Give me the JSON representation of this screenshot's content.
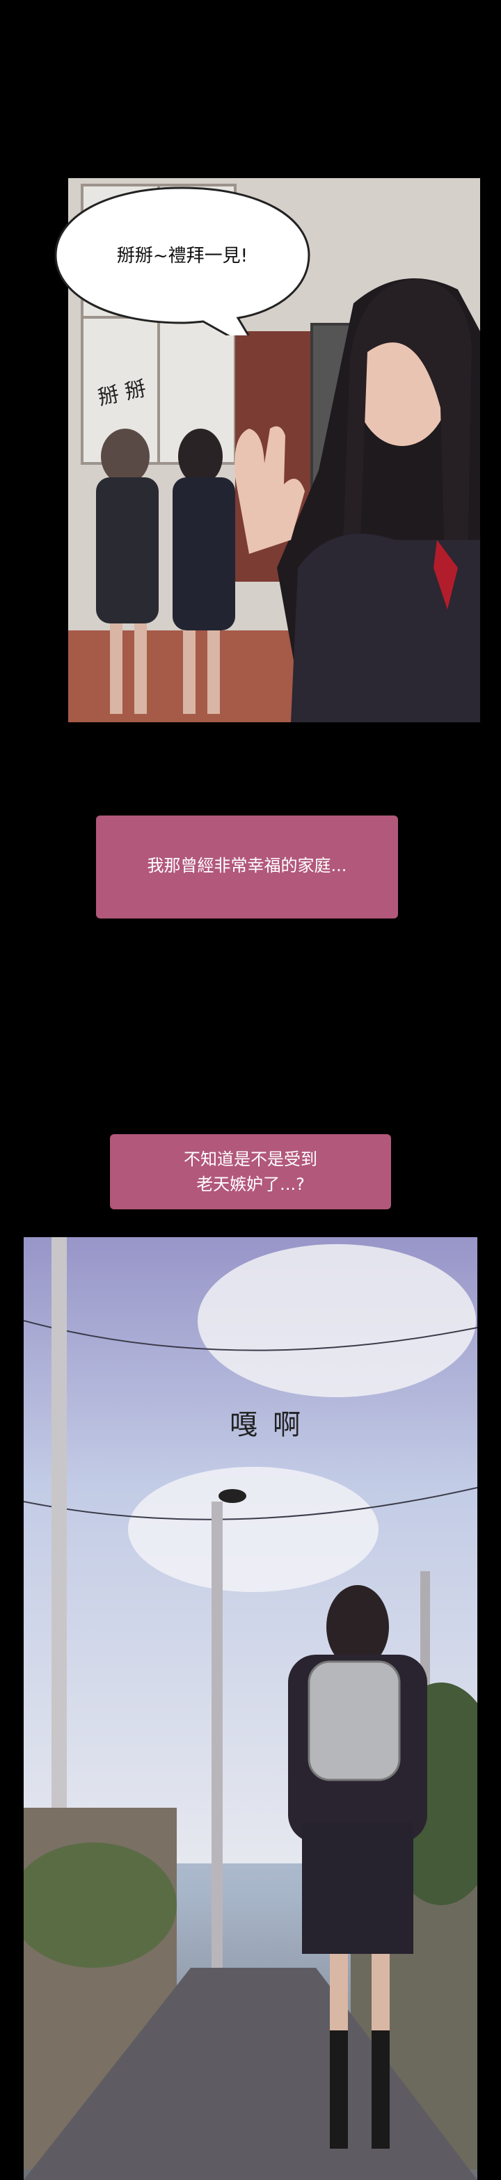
{
  "panel1": {
    "speech_bubble": "掰掰~禮拜一見!",
    "sfx": "掰 掰"
  },
  "captions": [
    "我那曾經非常幸福的家庭...",
    "不知道是不是受到\n老天嫉妒了...?"
  ],
  "panel2": {
    "sfx": "嘎啊"
  }
}
